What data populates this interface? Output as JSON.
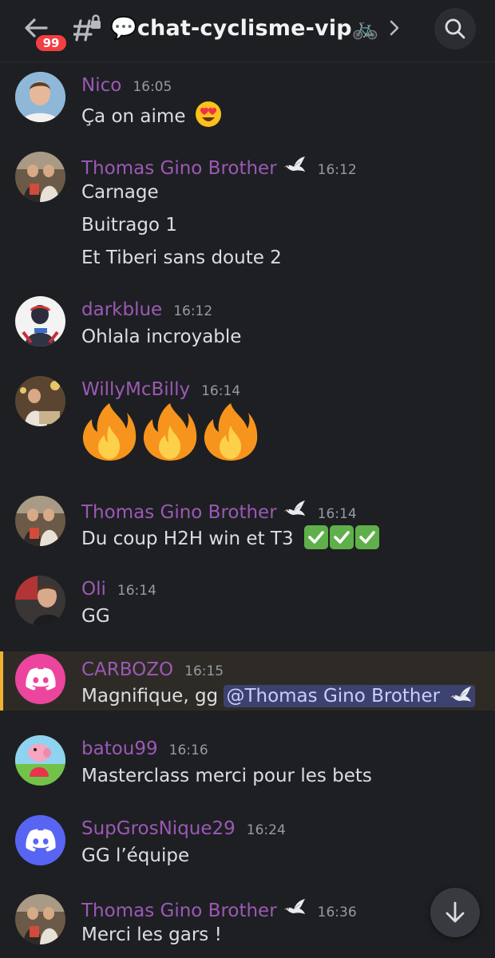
{
  "header": {
    "unread_badge": "99",
    "channel_name": "💬chat-cyclisme-vip🚲"
  },
  "messages": [
    {
      "author": "Nico",
      "time": "16:05",
      "lines": [
        "Ça on aime"
      ]
    },
    {
      "author": "Thomas Gino Brother",
      "time": "16:12",
      "lines": [
        "Carnage",
        "Buitrago 1",
        "Et Tiberi sans doute 2"
      ]
    },
    {
      "author": "darkblue",
      "time": "16:12",
      "lines": [
        "Ohlala incroyable"
      ]
    },
    {
      "author": "WillyMcBilly",
      "time": "16:14",
      "lines": []
    },
    {
      "author": "Thomas Gino Brother",
      "time": "16:14",
      "lines": [
        "Du coup H2H win et T3"
      ]
    },
    {
      "author": "Oli",
      "time": "16:14",
      "lines": [
        "GG"
      ]
    },
    {
      "author": "CARBOZO",
      "time": "16:15",
      "lines": [
        "Magnifique, gg "
      ],
      "mention": "@Thomas Gino Brother"
    },
    {
      "author": "batou99",
      "time": "16:16",
      "lines": [
        "Masterclass merci pour les bets"
      ]
    },
    {
      "author": "SupGrosNique29",
      "time": "16:24",
      "lines": [
        "GG l’équipe"
      ]
    },
    {
      "author": "Thomas Gino Brother",
      "time": "16:36",
      "lines": [
        "Merci les gars !"
      ]
    }
  ],
  "colors": {
    "background": "#1e1f22",
    "author": "#9b59b6",
    "timestamp": "#949ba4",
    "mention_bg": "#3c4270",
    "highlight_bar": "#f0b232",
    "badge": "#f23f43",
    "discord_pink": "#eb459e",
    "discord_blurple": "#5865f2"
  },
  "icons": {
    "back": "arrow-left-icon",
    "channel": "hash-lock-icon",
    "chevron": "chevron-right-icon",
    "search": "search-icon",
    "jump": "arrow-down-icon",
    "dove": "dove-emoji-icon",
    "fire": "fire-emoji-icon",
    "check": "check-mark-emoji-icon",
    "heart_eyes": "heart-eyes-emoji-icon"
  }
}
